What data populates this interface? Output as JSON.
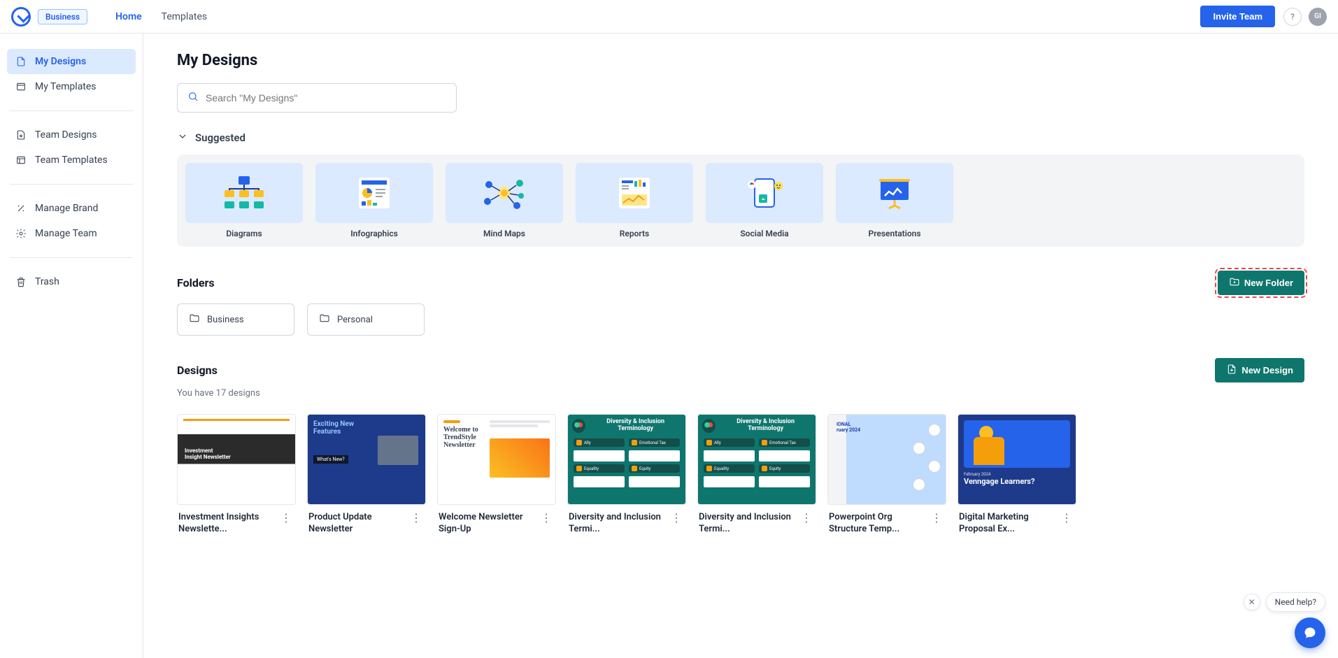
{
  "topbar": {
    "plan": "Business",
    "nav": {
      "home": "Home",
      "templates": "Templates"
    },
    "invite": "Invite Team",
    "help": "?",
    "avatar": "GI"
  },
  "sidebar": {
    "my_designs": "My Designs",
    "my_templates": "My Templates",
    "team_designs": "Team Designs",
    "team_templates": "Team Templates",
    "manage_brand": "Manage Brand",
    "manage_team": "Manage Team",
    "trash": "Trash"
  },
  "page": {
    "title": "My Designs",
    "search_placeholder": "Search \"My Designs\""
  },
  "suggested": {
    "heading": "Suggested",
    "items": {
      "diagrams": "Diagrams",
      "infographics": "Infographics",
      "mindmaps": "Mind Maps",
      "reports": "Reports",
      "social": "Social Media",
      "presentations": "Presentations"
    }
  },
  "folders": {
    "heading": "Folders",
    "new_btn": "New Folder",
    "items": {
      "business": "Business",
      "personal": "Personal"
    }
  },
  "designs": {
    "heading": "Designs",
    "sub": "You have 17 designs",
    "new_btn": "New Design",
    "items": [
      {
        "title": "Investment Insights Newslette..."
      },
      {
        "title": "Product Update Newsletter"
      },
      {
        "title": "Welcome Newsletter Sign-Up"
      },
      {
        "title": "Diversity and Inclusion Termi..."
      },
      {
        "title": "Diversity and Inclusion Termi..."
      },
      {
        "title": "Powerpoint Org Structure Temp..."
      },
      {
        "title": "Digital Marketing Proposal Ex..."
      }
    ]
  },
  "thumb": {
    "inv_line1": "Investment",
    "inv_line2": "Insight Newsletter",
    "prod_hd1": "Exciting New",
    "prod_hd2": "Features",
    "prod_wn": "What's New?",
    "news_t1": "Welcome to",
    "news_t2": "TrendStyle",
    "news_t3": "Newsletter",
    "div_tt": "Diversity & Inclusion Terminology",
    "div_p1": "Ally",
    "div_p2": "Emotional Tax",
    "div_p3": "Equality",
    "div_p4": "Equity",
    "ppt_txt": "IONAL",
    "ppt_txt2": "ruary 2024",
    "dig_dt": "February 2024",
    "dig_tt": "Venngage Learners?"
  },
  "help_widget": {
    "text": "Need help?"
  }
}
